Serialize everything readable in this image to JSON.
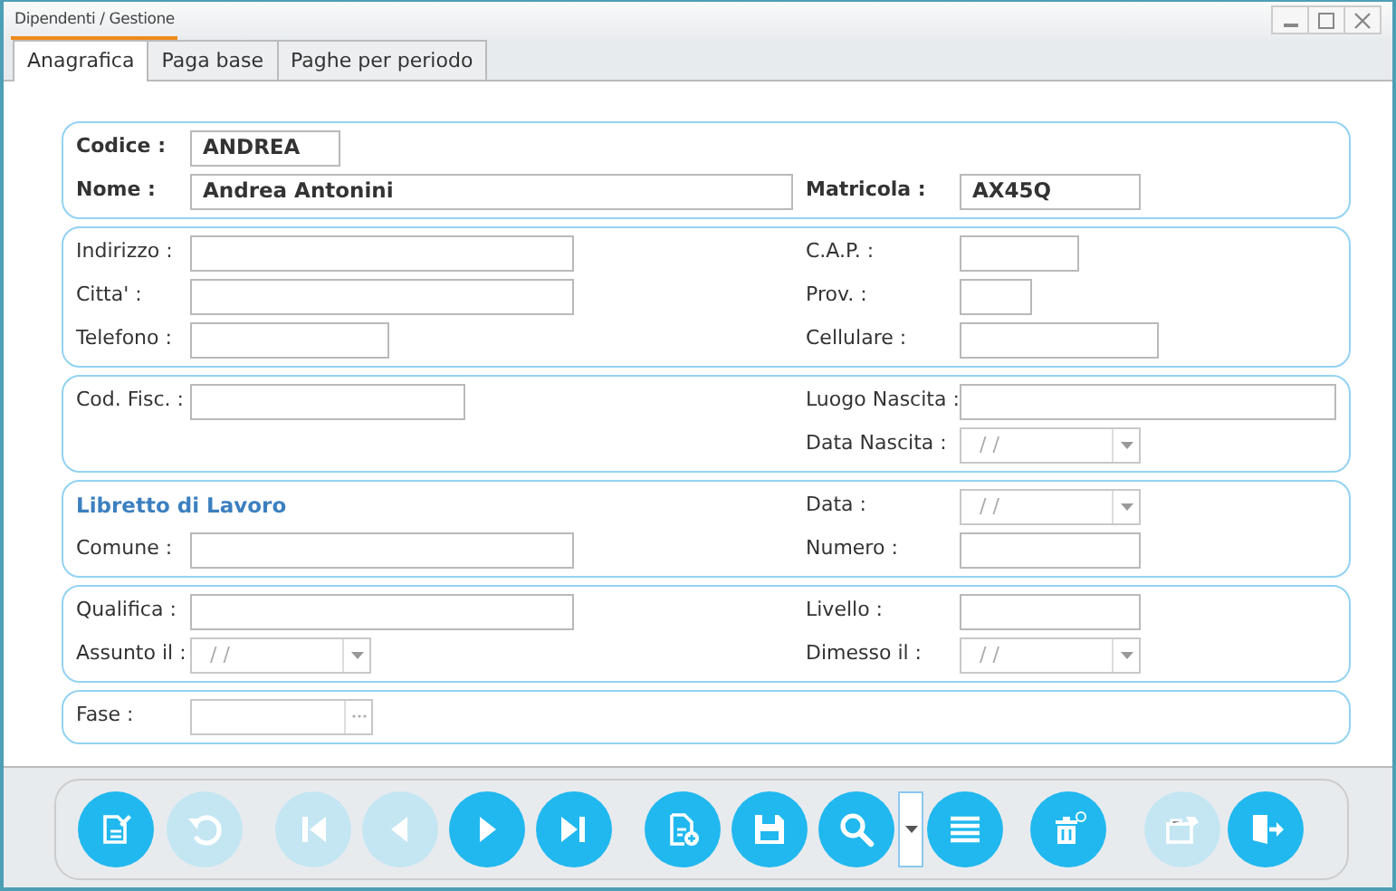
{
  "window": {
    "title": "Dipendenti / Gestione"
  },
  "tabs": [
    {
      "label": "Anagrafica",
      "selected": true
    },
    {
      "label": "Paga base",
      "selected": false
    },
    {
      "label": "Paghe per periodo",
      "selected": false
    }
  ],
  "sections": [
    {
      "kind": "key",
      "rows": [
        {
          "left": {
            "label": "Codice :",
            "value": "ANDREA",
            "kind": "text"
          }
        },
        {
          "left": {
            "label": "Nome :",
            "value": "Andrea Antonini",
            "kind": "text"
          },
          "right": {
            "label": "Matricola :",
            "value": "AX45Q",
            "kind": "text"
          }
        }
      ]
    },
    {
      "kind": "detail",
      "rows": [
        {
          "left": {
            "label": "Indirizzo :",
            "kind": "text"
          },
          "right": {
            "label": "C.A.P. :",
            "kind": "text"
          }
        },
        {
          "left": {
            "label": "Citta' :",
            "kind": "text"
          },
          "right": {
            "label": "Prov. :",
            "kind": "text"
          }
        },
        {
          "left": {
            "label": "Telefono :",
            "kind": "text"
          },
          "right": {
            "label": "Cellulare :",
            "kind": "text"
          }
        }
      ]
    },
    {
      "kind": "detail",
      "rows": [
        {
          "left": {
            "label": "Cod. Fisc. :",
            "kind": "text"
          },
          "right": {
            "label": "Luogo Nascita :",
            "kind": "text"
          }
        },
        {
          "right": {
            "label": "Data Nascita :",
            "kind": "date",
            "placeholder": "/ /"
          }
        }
      ]
    },
    {
      "kind": "detail",
      "heading": "Libretto di Lavoro",
      "rows": [
        {
          "right": {
            "label": "Data :",
            "kind": "date",
            "placeholder": "/ /"
          }
        },
        {
          "left": {
            "label": "Comune :",
            "kind": "text"
          },
          "right": {
            "label": "Numero :",
            "kind": "text"
          }
        }
      ]
    },
    {
      "kind": "detail",
      "rows": [
        {
          "left": {
            "label": "Qualifica :",
            "kind": "text"
          },
          "right": {
            "label": "Livello :",
            "kind": "text"
          }
        },
        {
          "left": {
            "label": "Assunto il :",
            "kind": "date",
            "placeholder": "/ /"
          },
          "right": {
            "label": "Dimesso il :",
            "kind": "date",
            "placeholder": "/ /"
          }
        }
      ]
    },
    {
      "kind": "detail",
      "rows": [
        {
          "left": {
            "label": "Fase :",
            "kind": "lookup"
          }
        }
      ]
    }
  ],
  "toolbar": [
    {
      "kind": "edit",
      "disabled": false
    },
    {
      "kind": "undo",
      "disabled": true
    },
    {
      "kind": "first",
      "disabled": true
    },
    {
      "kind": "prev",
      "disabled": true
    },
    {
      "kind": "next",
      "disabled": false
    },
    {
      "kind": "last",
      "disabled": false
    },
    {
      "kind": "new",
      "disabled": false
    },
    {
      "kind": "save",
      "disabled": false
    },
    {
      "kind": "search",
      "disabled": false
    },
    {
      "kind": "dropdown"
    },
    {
      "kind": "list",
      "disabled": false
    },
    {
      "kind": "delete",
      "disabled": false
    },
    {
      "kind": "archive",
      "disabled": true
    },
    {
      "kind": "exit",
      "disabled": false
    }
  ]
}
